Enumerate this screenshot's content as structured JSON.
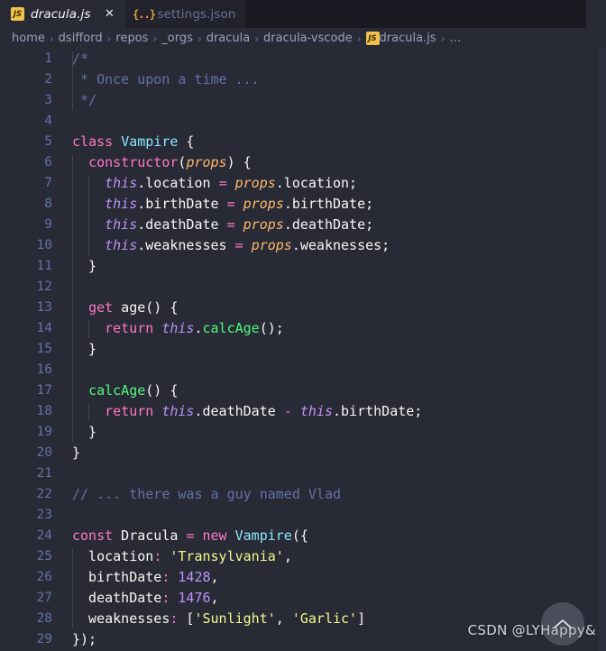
{
  "window": {
    "app": "Visual Studio Code",
    "theme": "Dracula",
    "colors": {
      "editor_background": "#282a36",
      "tabbar_background": "#191a21",
      "inactive_tab_background": "#21222c",
      "line_number": "#6272a4",
      "comment": "#6272a4",
      "keyword": "#ff79c6",
      "class_name": "#8be9fd",
      "function": "#50fa7b",
      "this_keyword": "#bd93f9",
      "parameter": "#ffb86c",
      "string": "#f1fa8c",
      "number": "#bd93f9",
      "foreground": "#f8f8f2"
    }
  },
  "tabs": [
    {
      "label": "dracula.js",
      "icon": "js-file-icon",
      "icon_text": "JS",
      "active": true,
      "preview_italic": true,
      "close_label": "✕"
    },
    {
      "label": "settings.json",
      "icon": "json-file-icon",
      "icon_text": "{..}",
      "active": false,
      "preview_italic": false,
      "close_label": ""
    }
  ],
  "breadcrumb": {
    "separator": "›",
    "items": [
      "home",
      "dsifford",
      "repos",
      "_orgs",
      "dracula",
      "dracula-vscode"
    ],
    "file": "dracula.js",
    "file_icon_text": "JS",
    "trailing": "…"
  },
  "editor": {
    "language": "javascript",
    "first_line": 1,
    "last_line": 29,
    "lines": [
      {
        "n": "1",
        "tokens": [
          {
            "t": "comment",
            "v": "/*"
          }
        ]
      },
      {
        "n": "2",
        "tokens": [
          {
            "t": "comment",
            "v": " * Once upon a time ..."
          }
        ]
      },
      {
        "n": "3",
        "tokens": [
          {
            "t": "comment",
            "v": " */"
          }
        ]
      },
      {
        "n": "4",
        "tokens": []
      },
      {
        "n": "5",
        "tokens": [
          {
            "t": "key",
            "v": "class"
          },
          {
            "t": "plain",
            "v": " "
          },
          {
            "t": "class",
            "v": "Vampire"
          },
          {
            "t": "plain",
            "v": " {"
          }
        ]
      },
      {
        "n": "6",
        "tokens": [
          {
            "t": "plain",
            "v": "  "
          },
          {
            "t": "key",
            "v": "constructor"
          },
          {
            "t": "plain",
            "v": "("
          },
          {
            "t": "param",
            "v": "props"
          },
          {
            "t": "plain",
            "v": ") {"
          }
        ]
      },
      {
        "n": "7",
        "tokens": [
          {
            "t": "plain",
            "v": "    "
          },
          {
            "t": "this",
            "v": "this"
          },
          {
            "t": "plain",
            "v": ".location "
          },
          {
            "t": "op",
            "v": "="
          },
          {
            "t": "plain",
            "v": " "
          },
          {
            "t": "param",
            "v": "props"
          },
          {
            "t": "plain",
            "v": ".location;"
          }
        ]
      },
      {
        "n": "8",
        "tokens": [
          {
            "t": "plain",
            "v": "    "
          },
          {
            "t": "this",
            "v": "this"
          },
          {
            "t": "plain",
            "v": ".birthDate "
          },
          {
            "t": "op",
            "v": "="
          },
          {
            "t": "plain",
            "v": " "
          },
          {
            "t": "param",
            "v": "props"
          },
          {
            "t": "plain",
            "v": ".birthDate;"
          }
        ]
      },
      {
        "n": "9",
        "tokens": [
          {
            "t": "plain",
            "v": "    "
          },
          {
            "t": "this",
            "v": "this"
          },
          {
            "t": "plain",
            "v": ".deathDate "
          },
          {
            "t": "op",
            "v": "="
          },
          {
            "t": "plain",
            "v": " "
          },
          {
            "t": "param",
            "v": "props"
          },
          {
            "t": "plain",
            "v": ".deathDate;"
          }
        ]
      },
      {
        "n": "10",
        "tokens": [
          {
            "t": "plain",
            "v": "    "
          },
          {
            "t": "this",
            "v": "this"
          },
          {
            "t": "plain",
            "v": ".weaknesses "
          },
          {
            "t": "op",
            "v": "="
          },
          {
            "t": "plain",
            "v": " "
          },
          {
            "t": "param",
            "v": "props"
          },
          {
            "t": "plain",
            "v": ".weaknesses;"
          }
        ]
      },
      {
        "n": "11",
        "tokens": [
          {
            "t": "plain",
            "v": "  }"
          }
        ]
      },
      {
        "n": "12",
        "tokens": []
      },
      {
        "n": "13",
        "tokens": [
          {
            "t": "plain",
            "v": "  "
          },
          {
            "t": "key",
            "v": "get"
          },
          {
            "t": "plain",
            "v": " age() {"
          }
        ]
      },
      {
        "n": "14",
        "tokens": [
          {
            "t": "plain",
            "v": "    "
          },
          {
            "t": "key",
            "v": "return"
          },
          {
            "t": "plain",
            "v": " "
          },
          {
            "t": "this",
            "v": "this"
          },
          {
            "t": "plain",
            "v": "."
          },
          {
            "t": "fn",
            "v": "calcAge"
          },
          {
            "t": "plain",
            "v": "();"
          }
        ]
      },
      {
        "n": "15",
        "tokens": [
          {
            "t": "plain",
            "v": "  }"
          }
        ]
      },
      {
        "n": "16",
        "tokens": []
      },
      {
        "n": "17",
        "tokens": [
          {
            "t": "plain",
            "v": "  "
          },
          {
            "t": "fn",
            "v": "calcAge"
          },
          {
            "t": "plain",
            "v": "() {"
          }
        ]
      },
      {
        "n": "18",
        "tokens": [
          {
            "t": "plain",
            "v": "    "
          },
          {
            "t": "key",
            "v": "return"
          },
          {
            "t": "plain",
            "v": " "
          },
          {
            "t": "this",
            "v": "this"
          },
          {
            "t": "plain",
            "v": ".deathDate "
          },
          {
            "t": "op",
            "v": "-"
          },
          {
            "t": "plain",
            "v": " "
          },
          {
            "t": "this",
            "v": "this"
          },
          {
            "t": "plain",
            "v": ".birthDate;"
          }
        ]
      },
      {
        "n": "19",
        "tokens": [
          {
            "t": "plain",
            "v": "  }"
          }
        ]
      },
      {
        "n": "20",
        "tokens": [
          {
            "t": "plain",
            "v": "}"
          }
        ]
      },
      {
        "n": "21",
        "tokens": []
      },
      {
        "n": "22",
        "tokens": [
          {
            "t": "comment",
            "v": "// ... there was a guy named Vlad"
          }
        ]
      },
      {
        "n": "23",
        "tokens": []
      },
      {
        "n": "24",
        "tokens": [
          {
            "t": "key",
            "v": "const"
          },
          {
            "t": "plain",
            "v": " Dracula "
          },
          {
            "t": "op",
            "v": "="
          },
          {
            "t": "plain",
            "v": " "
          },
          {
            "t": "key",
            "v": "new"
          },
          {
            "t": "plain",
            "v": " "
          },
          {
            "t": "class",
            "v": "Vampire"
          },
          {
            "t": "plain",
            "v": "({"
          }
        ]
      },
      {
        "n": "25",
        "tokens": [
          {
            "t": "plain",
            "v": "  location"
          },
          {
            "t": "op",
            "v": ":"
          },
          {
            "t": "plain",
            "v": " "
          },
          {
            "t": "str",
            "v": "'Transylvania'"
          },
          {
            "t": "plain",
            "v": ","
          }
        ]
      },
      {
        "n": "26",
        "tokens": [
          {
            "t": "plain",
            "v": "  birthDate"
          },
          {
            "t": "op",
            "v": ":"
          },
          {
            "t": "plain",
            "v": " "
          },
          {
            "t": "num",
            "v": "1428"
          },
          {
            "t": "plain",
            "v": ","
          }
        ]
      },
      {
        "n": "27",
        "tokens": [
          {
            "t": "plain",
            "v": "  deathDate"
          },
          {
            "t": "op",
            "v": ":"
          },
          {
            "t": "plain",
            "v": " "
          },
          {
            "t": "num",
            "v": "1476"
          },
          {
            "t": "plain",
            "v": ","
          }
        ]
      },
      {
        "n": "28",
        "tokens": [
          {
            "t": "plain",
            "v": "  weaknesses"
          },
          {
            "t": "op",
            "v": ":"
          },
          {
            "t": "plain",
            "v": " ["
          },
          {
            "t": "str",
            "v": "'Sunlight'"
          },
          {
            "t": "plain",
            "v": ", "
          },
          {
            "t": "str",
            "v": "'Garlic'"
          },
          {
            "t": "plain",
            "v": "]"
          }
        ]
      },
      {
        "n": "29",
        "tokens": [
          {
            "t": "plain",
            "v": "});"
          }
        ]
      }
    ],
    "indent_guides": [
      {
        "col": 0,
        "from_line": 1,
        "to_line": 3
      },
      {
        "col": 0,
        "from_line": 6,
        "to_line": 19
      },
      {
        "col": 1,
        "from_line": 7,
        "to_line": 10
      },
      {
        "col": 1,
        "from_line": 14,
        "to_line": 14
      },
      {
        "col": 1,
        "from_line": 18,
        "to_line": 18
      },
      {
        "col": 0,
        "from_line": 25,
        "to_line": 28
      }
    ]
  },
  "overlay": {
    "watermark": "CSDN @LYHappy&",
    "scroll_top_icon": "chevron-up-icon"
  }
}
